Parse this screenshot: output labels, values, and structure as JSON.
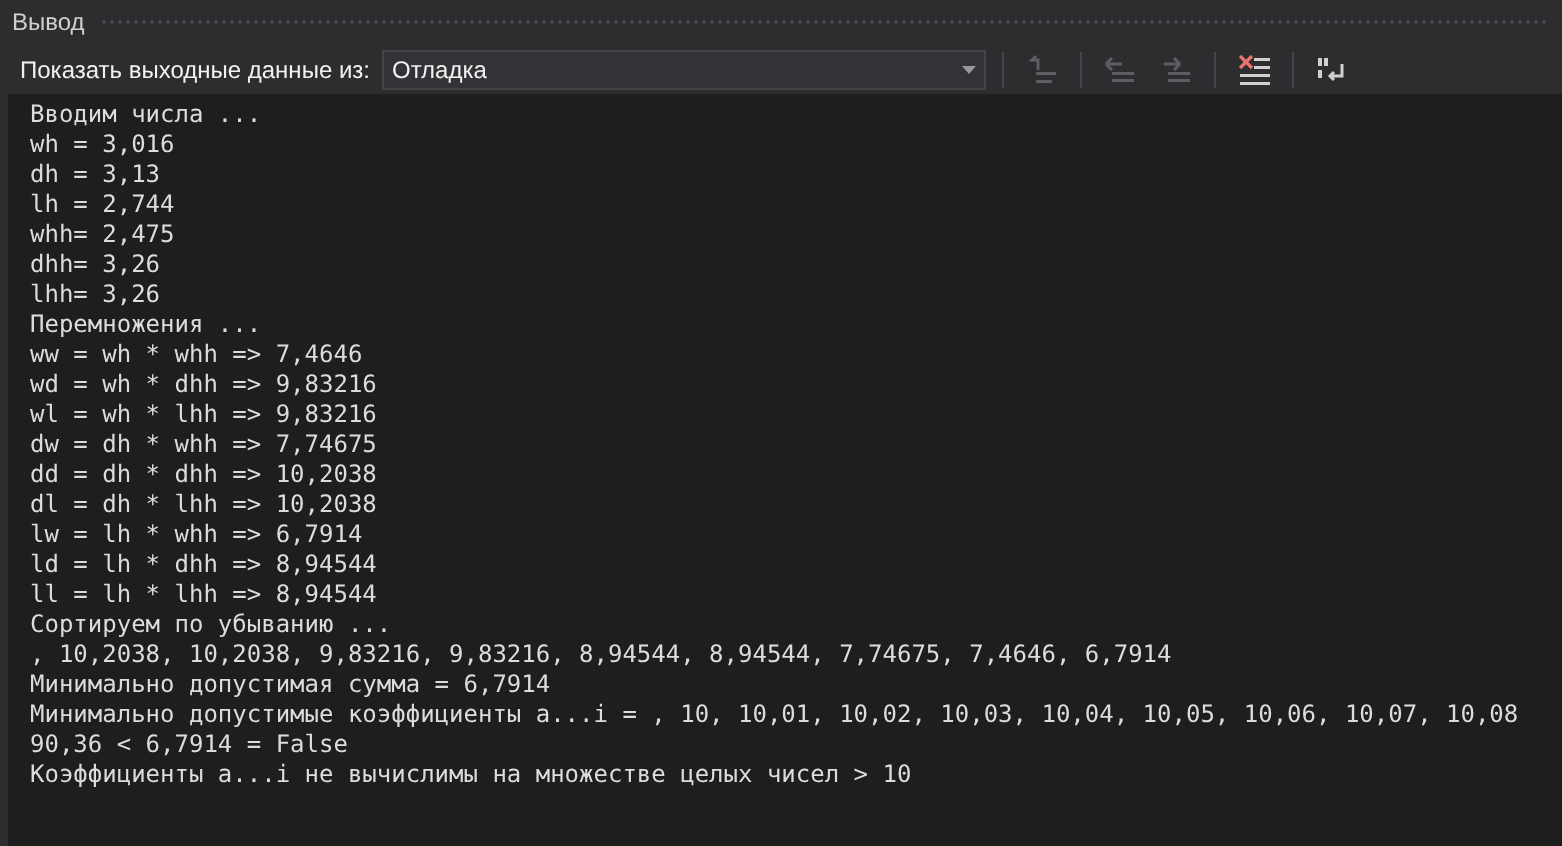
{
  "window": {
    "title": "Вывод"
  },
  "toolbar": {
    "source_label": "Показать выходные данные из:",
    "source_value": "Отладка",
    "buttons": [
      {
        "kind": "goto",
        "disabled": true
      },
      {
        "kind": "prev",
        "disabled": true
      },
      {
        "kind": "next",
        "disabled": true
      },
      {
        "kind": "clear",
        "disabled": false
      },
      {
        "kind": "wrap",
        "disabled": false
      }
    ]
  },
  "output_lines": [
    "Вводим числа ...",
    "wh = 3,016",
    "dh = 3,13",
    "lh = 2,744",
    "whh= 2,475",
    "dhh= 3,26",
    "lhh= 3,26",
    "Перемножения ...",
    "ww = wh * whh => 7,4646",
    "wd = wh * dhh => 9,83216",
    "wl = wh * lhh => 9,83216",
    "dw = dh * whh => 7,74675",
    "dd = dh * dhh => 10,2038",
    "dl = dh * lhh => 10,2038",
    "lw = lh * whh => 6,7914",
    "ld = lh * dhh => 8,94544",
    "ll = lh * lhh => 8,94544",
    "Сортируем по убыванию ...",
    ", 10,2038, 10,2038, 9,83216, 9,83216, 8,94544, 8,94544, 7,74675, 7,4646, 6,7914",
    "Минимально допустимая сумма = 6,7914",
    "Минимально допустимые коэффициенты a...i = , 10, 10,01, 10,02, 10,03, 10,04, 10,05, 10,06, 10,07, 10,08",
    "90,36 < 6,7914 = False",
    "Коэффициенты a...i не вычислимы на множестве целых чисел > 10"
  ]
}
